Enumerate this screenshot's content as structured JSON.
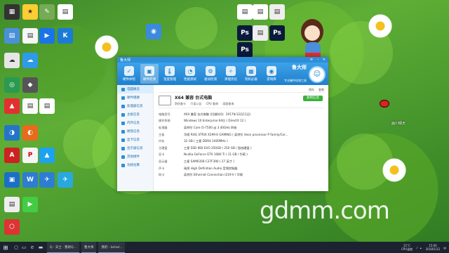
{
  "window": {
    "title": "鲁大师",
    "toolbar": [
      {
        "label": "硬件体检",
        "icon": "shield-icon",
        "glyph": "✓"
      },
      {
        "label": "硬件检测",
        "icon": "chip-icon",
        "glyph": "▣"
      },
      {
        "label": "温度管理",
        "icon": "thermometer-icon",
        "glyph": "🌡"
      },
      {
        "label": "性能测试",
        "icon": "speed-icon",
        "glyph": "◔"
      },
      {
        "label": "驱动检测",
        "icon": "driver-icon",
        "glyph": "⚙"
      },
      {
        "label": "清理优化",
        "icon": "broom-icon",
        "glyph": "✧"
      },
      {
        "label": "装机必备",
        "icon": "box-icon",
        "glyph": "▦"
      },
      {
        "label": "游戏库",
        "icon": "gamepad-icon",
        "glyph": "◉"
      }
    ],
    "brand": {
      "name": "鲁大师",
      "slogan": "专业硬件检测工具"
    },
    "sidebar": [
      {
        "label": "电脑概览"
      },
      {
        "label": "硬件健康"
      },
      {
        "label": "处理器信息"
      },
      {
        "label": "主板信息"
      },
      {
        "label": "内存信息"
      },
      {
        "label": "硬盘信息"
      },
      {
        "label": "显卡信息"
      },
      {
        "label": "显示器信息"
      },
      {
        "label": "其他硬件"
      },
      {
        "label": "功耗估算"
      }
    ],
    "content_bar": [
      "保存",
      "复制"
    ],
    "machine": {
      "name": "X64 兼容 台式电脑",
      "options": [
        "防伪查卡",
        "只读公告",
        "CPU 查询",
        "深度查询"
      ],
      "copy_button": "复制信息"
    },
    "specs": [
      {
        "k": "电脑型号",
        "v": "X64 兼容 台式电脑  (扫描时间：2017年12月11日)"
      },
      {
        "k": "操作系统",
        "v": "Windows 10 Enterprise 64位 ( DirectX 12 )"
      },
      {
        "k": "处理器",
        "v": "英特尔 Core i5-7500 @ 3.40GHz 四核"
      },
      {
        "k": "主板",
        "v": "华硕 ROG STRIX X299-E GAMING ( 英特尔 Xeon processor P family/Cor..."
      },
      {
        "k": "内存",
        "v": "32 GB ( 三星 DDR4 2400MHz )"
      },
      {
        "k": "主硬盘",
        "v": "三星 SSD 960 EVO 250GB ( 250 GB / 固态硬盘 )"
      },
      {
        "k": "显卡",
        "v": "Nvidia GeForce GTX 1080 Ti ( 11 GB / 华硕 )"
      },
      {
        "k": "显示器",
        "v": "三星 SAM0358 C27F390 ( 27 英寸 )"
      },
      {
        "k": "声卡",
        "v": "瑞昱 High Definition Audio 音频控制器"
      },
      {
        "k": "网卡",
        "v": "英特尔 Ethernet Connection I219-V / 华硕"
      }
    ]
  },
  "taskbar": {
    "apps": [
      {
        "label": "Q · 天士 · 我的Q..."
      },
      {
        "label": "鲁大师"
      },
      {
        "label": "我的 - bchel..."
      }
    ],
    "tray": {
      "temp": "21°C",
      "temp_label": "CPU温度",
      "time": "15:00",
      "date": "2018/1/12"
    }
  },
  "watermark": "gdmm.com",
  "brand_art": "画川晴天"
}
